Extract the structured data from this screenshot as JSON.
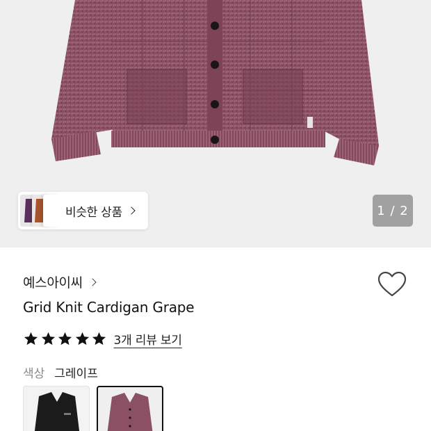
{
  "gallery": {
    "similar_label": "비슷한 상품",
    "page_counter": "1 / 2"
  },
  "product": {
    "brand": "예스아이씨",
    "title": "Grid Knit Cardigan Grape",
    "rating": 5,
    "review_link": "3개 리뷰 보기",
    "color_label": "색상",
    "color_value": "그레이프",
    "swatches": [
      {
        "name": "black",
        "selected": false
      },
      {
        "name": "grape",
        "selected": true
      }
    ]
  },
  "colors": {
    "grape": "#8a4f63",
    "black": "#1a1a1a",
    "star": "#111111"
  }
}
